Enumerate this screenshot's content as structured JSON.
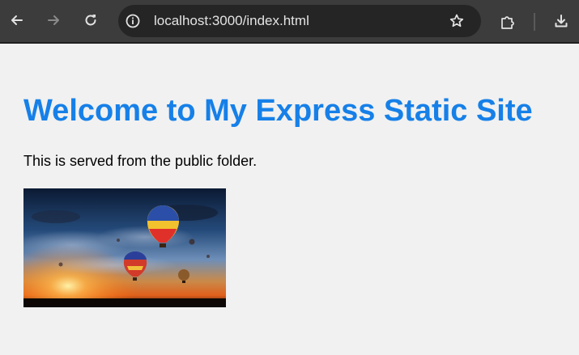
{
  "browser": {
    "url": "localhost:3000/index.html",
    "icons": {
      "back": "arrow-left-icon",
      "forward": "arrow-right-icon",
      "reload": "reload-icon",
      "site_info": "info-icon",
      "bookmark": "star-icon",
      "extensions": "puzzle-icon",
      "downloads": "download-icon"
    }
  },
  "page": {
    "heading": "Welcome to My Express Static Site",
    "paragraph": "This is served from the public folder."
  },
  "colors": {
    "heading": "#1680e8",
    "page_background": "#f1f1f1",
    "toolbar_background": "#3c3c3c",
    "omnibox_background": "#252525"
  }
}
